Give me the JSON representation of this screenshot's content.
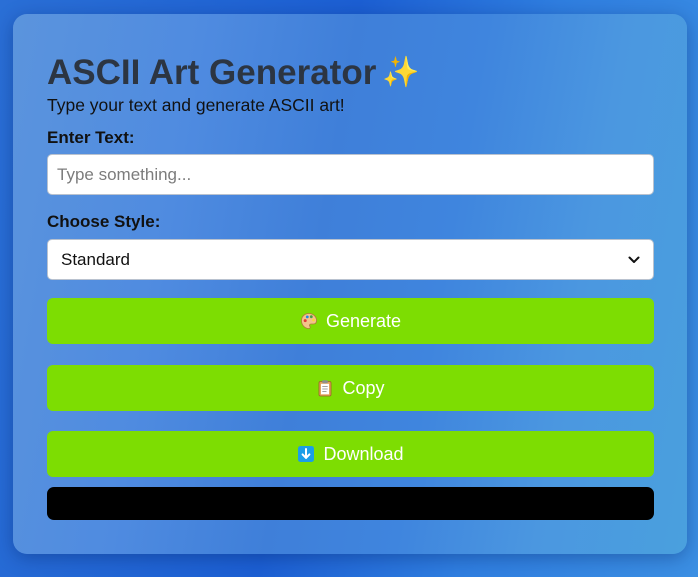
{
  "app": {
    "title": "ASCII Art Generator",
    "title_icon": "sparkles-icon",
    "subtitle": "Type your text and generate ASCII art!"
  },
  "text_field": {
    "label": "Enter Text:",
    "value": "",
    "placeholder": "Type something..."
  },
  "style_field": {
    "label": "Choose Style:",
    "selected": "Standard"
  },
  "buttons": {
    "generate": {
      "label": "Generate",
      "icon": "palette-icon"
    },
    "copy": {
      "label": "Copy",
      "icon": "clipboard-icon"
    },
    "download": {
      "label": "Download",
      "icon": "down-arrow-icon"
    }
  },
  "output": {
    "text": ""
  },
  "colors": {
    "button_bg": "#7ddd02",
    "title_color": "#2c3542",
    "output_bg": "#000000"
  }
}
